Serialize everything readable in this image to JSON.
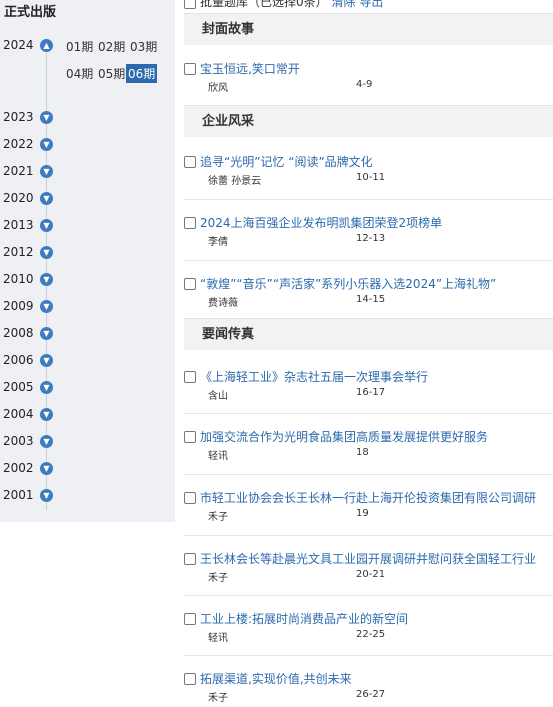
{
  "sidebar": {
    "title": "正式出版",
    "current_year": "2024",
    "issues": [
      "01期",
      "02期",
      "03期",
      "04期",
      "05期",
      "06期"
    ],
    "active_issue": "06期",
    "years": [
      "2023",
      "2022",
      "2021",
      "2020",
      "2013",
      "2012",
      "2010",
      "2009",
      "2008",
      "2006",
      "2005",
      "2004",
      "2003",
      "2002",
      "2001"
    ]
  },
  "top_row": {
    "text": "批量题库（已选择0条）",
    "clear_label": "清除",
    "export_label": "导出"
  },
  "sections": [
    {
      "heading": "封面故事",
      "articles": [
        {
          "title": "宝玉恒远,笑口常开",
          "author": "欣风",
          "pages": "4-9"
        }
      ]
    },
    {
      "heading": "企业风采",
      "articles": [
        {
          "title": "追寻“光明”记忆 “阅读”品牌文化",
          "author": "徐蕾 孙景云",
          "pages": "10-11"
        },
        {
          "title": "2024上海百强企业发布明凯集团荣登2项榜单",
          "author": "李倩",
          "pages": "12-13"
        },
        {
          "title": "“敦煌”“音乐”“声活家”系列小乐器入选2024”上海礼物”",
          "author": "费诗薇",
          "pages": "14-15"
        }
      ]
    },
    {
      "heading": "要闻传真",
      "articles": [
        {
          "title": "《上海轻工业》杂志社五届一次理事会举行",
          "author": "含山",
          "pages": "16-17"
        },
        {
          "title": "加强交流合作为光明食品集团高质量发展提供更好服务",
          "author": "轻讯",
          "pages": "18"
        },
        {
          "title": "市轻工业协会会长王长林一行赴上海开伦投资集团有限公司调研",
          "author": "禾子",
          "pages": "19"
        },
        {
          "title": "王长林会长等赴晨光文具工业园开展调研并慰问获全国轻工行业",
          "author": "禾子",
          "pages": "20-21"
        },
        {
          "title": "工业上楼:拓展时尚消费品产业的新空间",
          "author": "轻讯",
          "pages": "22-25"
        },
        {
          "title": "拓展渠道,实现价值,共创未来",
          "author": "禾子",
          "pages": "26-27"
        }
      ]
    }
  ]
}
